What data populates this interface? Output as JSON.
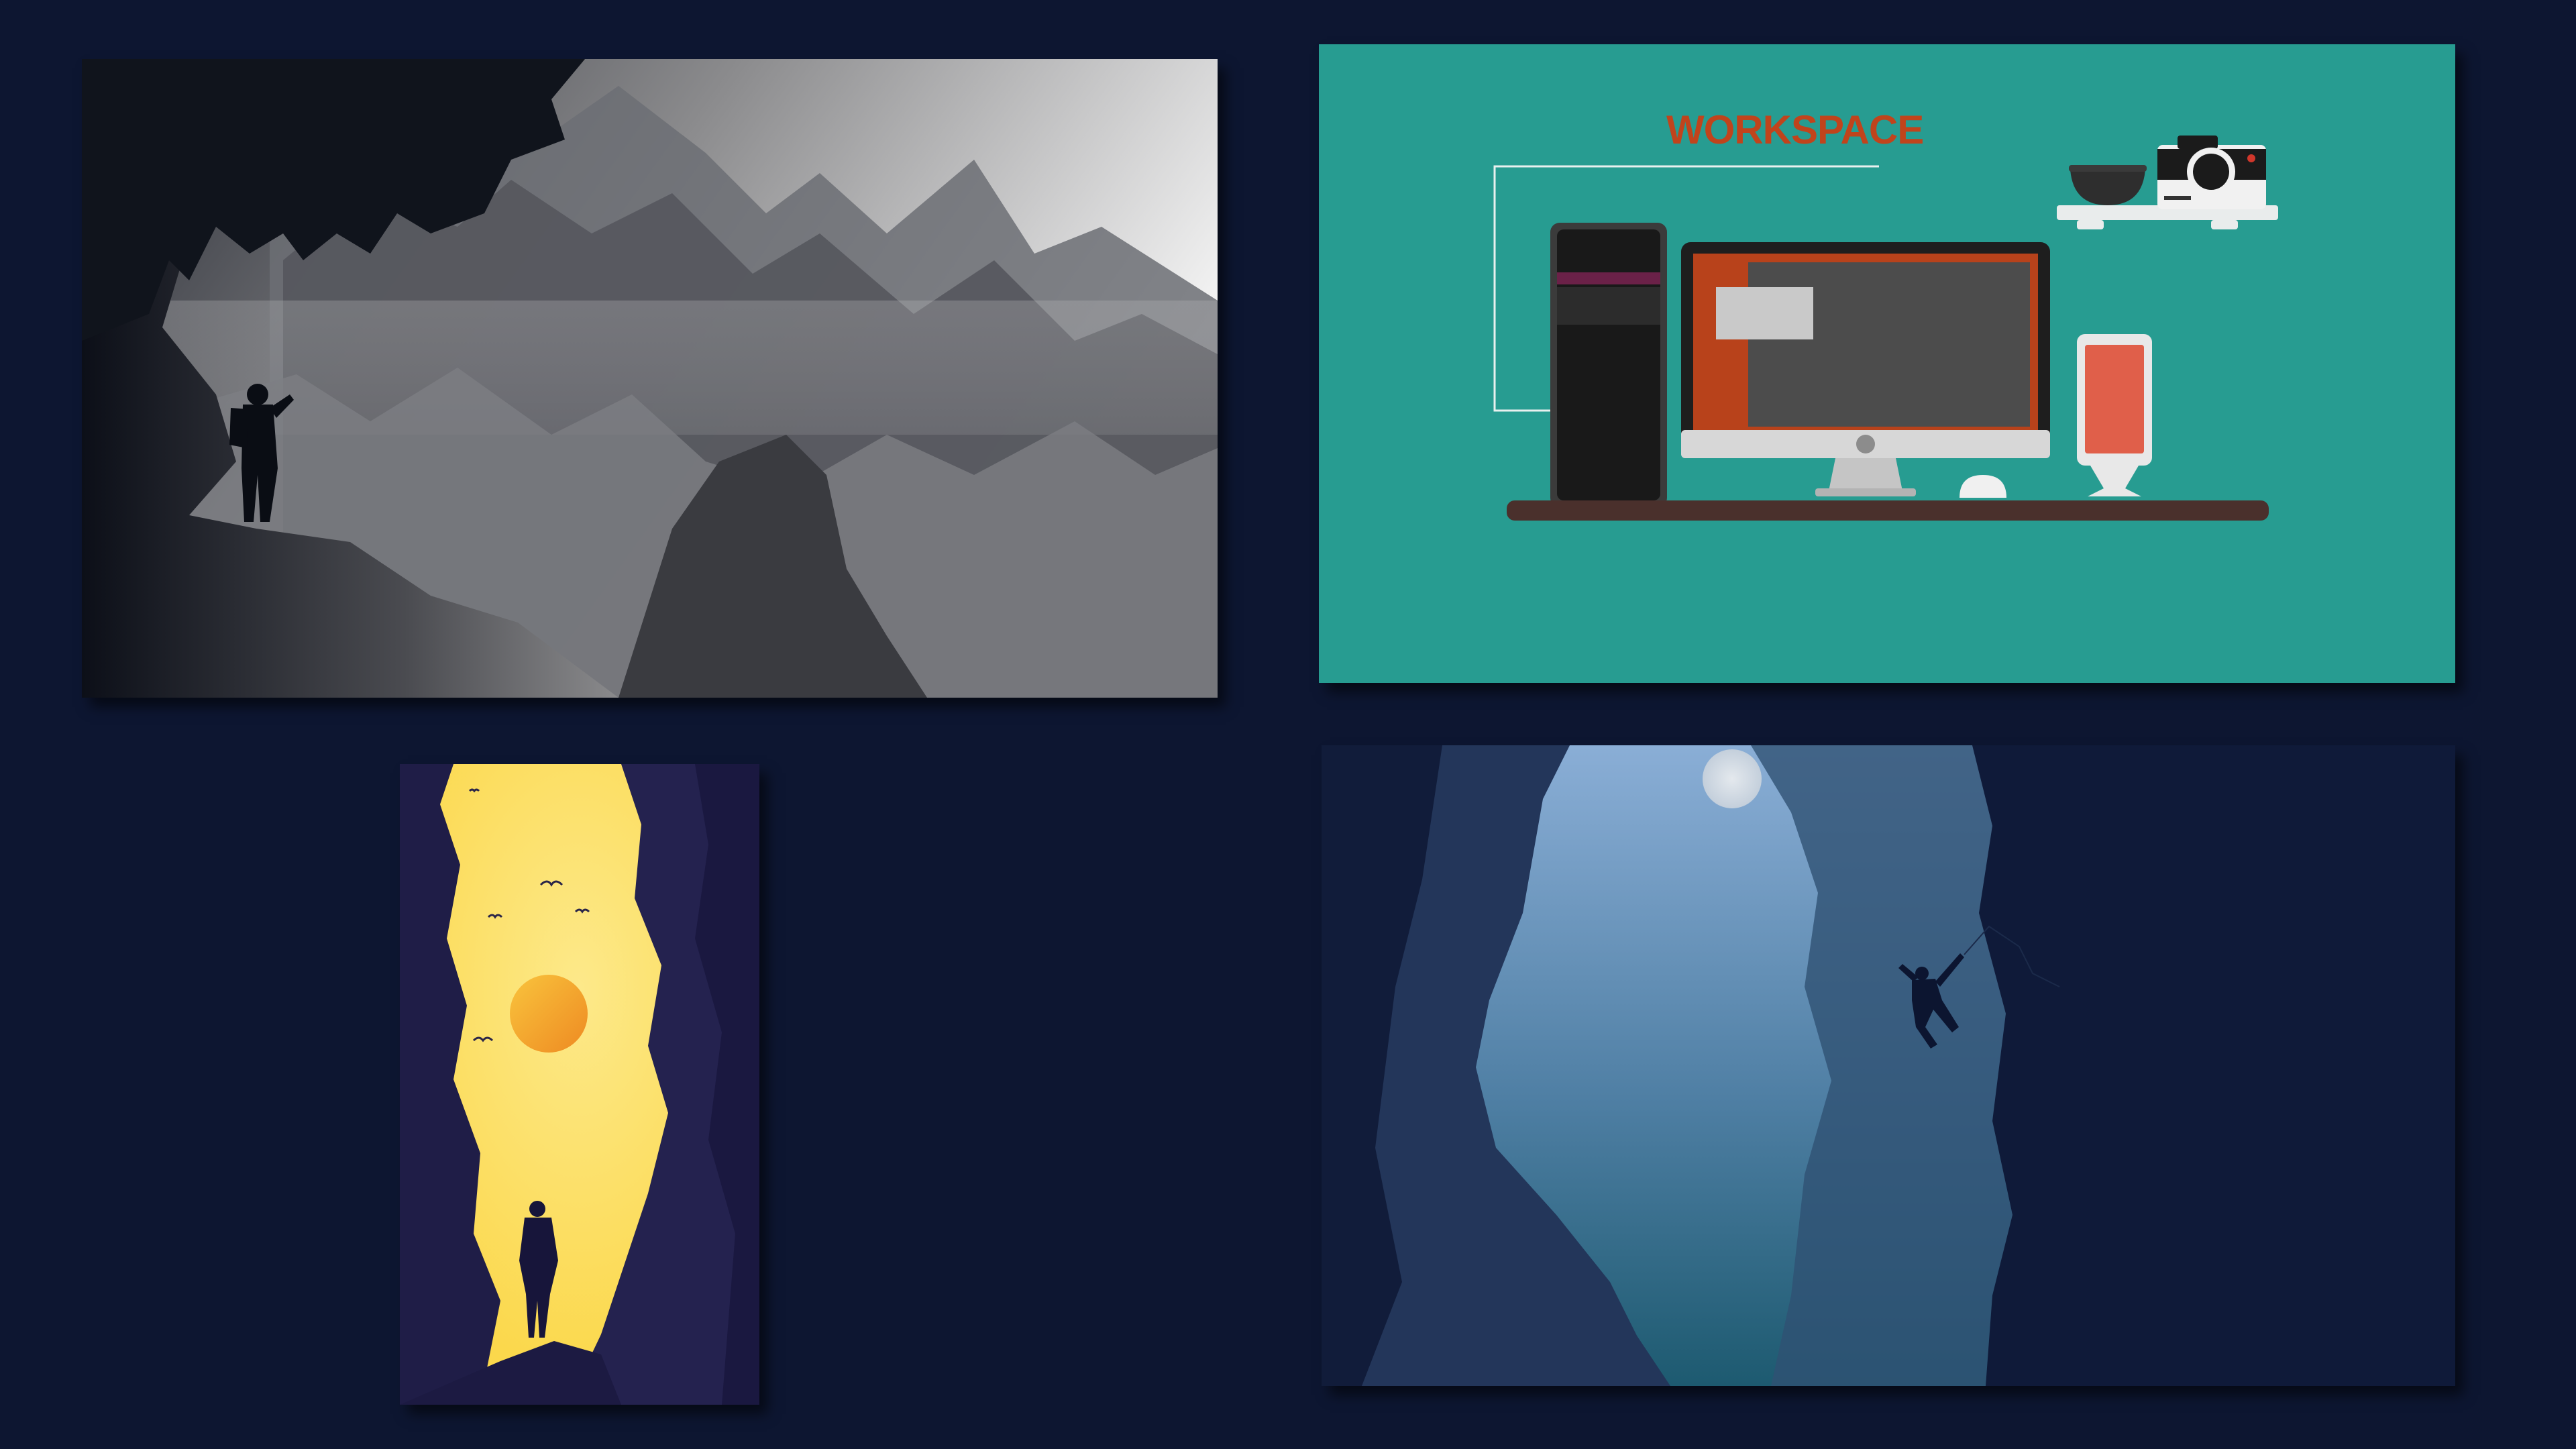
{
  "canvas": {
    "background_color": "#0d1631"
  },
  "artboards": [
    {
      "id": "mountains",
      "description_icon": "hiker-on-cliff-illustration",
      "colors": {
        "sky_light": "#f2f2f2",
        "sky_mid": "#9a9a9a",
        "foreground": "#0c0f18"
      }
    },
    {
      "id": "workspace",
      "title": "WORKSPACE",
      "colors": {
        "background": "#279c91",
        "title": "#c0441c",
        "desk": "#4a302c",
        "screen_frame": "#b8421b",
        "phone": "#e05f4a"
      }
    },
    {
      "id": "canyon",
      "description_icon": "canyon-wanderer-illustration",
      "colors": {
        "light": "#fde16a",
        "sun": "#f3a42a",
        "rock": "#1f1d47"
      }
    },
    {
      "id": "climber",
      "description_icon": "rock-climber-illustration",
      "colors": {
        "sky": "#87a9d2",
        "mist": "#26627a",
        "rock": "#0f1a39"
      }
    }
  ]
}
